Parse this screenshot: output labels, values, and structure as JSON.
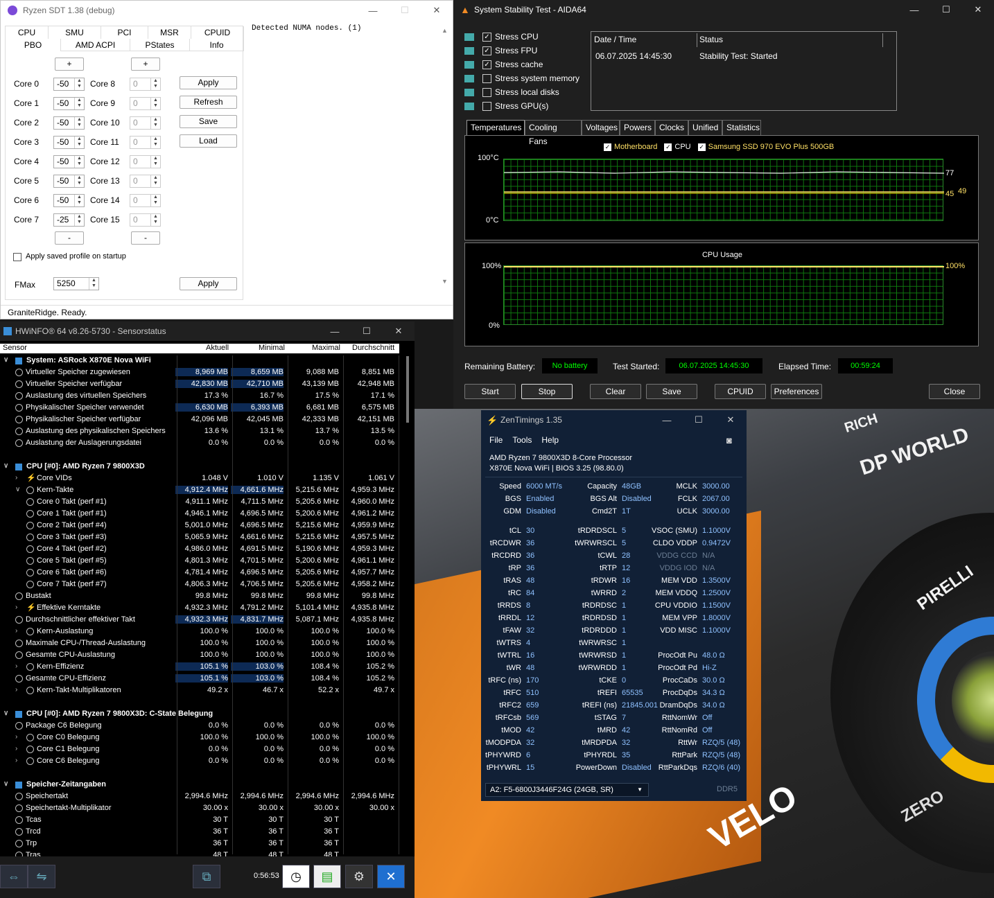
{
  "sdt": {
    "title": "Ryzen SDT 1.38 (debug)",
    "tabs_row1": [
      "CPU",
      "SMU",
      "PCI",
      "MSR",
      "CPUID"
    ],
    "tabs_row2": [
      "PBO",
      "AMD ACPI",
      "PStates",
      "Info"
    ],
    "cores_left": [
      {
        "label": "Core 0",
        "value": "-50"
      },
      {
        "label": "Core 1",
        "value": "-50"
      },
      {
        "label": "Core 2",
        "value": "-50"
      },
      {
        "label": "Core 3",
        "value": "-50"
      },
      {
        "label": "Core 4",
        "value": "-50"
      },
      {
        "label": "Core 5",
        "value": "-50"
      },
      {
        "label": "Core 6",
        "value": "-50"
      },
      {
        "label": "Core 7",
        "value": "-25"
      }
    ],
    "cores_right": [
      {
        "label": "Core 8",
        "value": "0"
      },
      {
        "label": "Core 9",
        "value": "0"
      },
      {
        "label": "Core 10",
        "value": "0"
      },
      {
        "label": "Core 11",
        "value": "0"
      },
      {
        "label": "Core 12",
        "value": "0"
      },
      {
        "label": "Core 13",
        "value": "0"
      },
      {
        "label": "Core 14",
        "value": "0"
      },
      {
        "label": "Core 15",
        "value": "0"
      }
    ],
    "plus": "+",
    "minus": "-",
    "buttons": [
      "Apply",
      "Refresh",
      "Save",
      "Load"
    ],
    "apply_startup": "Apply saved profile on startup",
    "fmax_label": "FMax",
    "fmax_value": "5250",
    "fmax_apply": "Apply",
    "log": "Detected NUMA nodes. (1)",
    "status": "GraniteRidge. Ready."
  },
  "aida": {
    "title": "System Stability Test - AIDA64",
    "stress": [
      {
        "label": "Stress CPU",
        "checked": "✓"
      },
      {
        "label": "Stress FPU",
        "checked": "✓"
      },
      {
        "label": "Stress cache",
        "checked": "✓"
      },
      {
        "label": "Stress system memory",
        "checked": ""
      },
      {
        "label": "Stress local disks",
        "checked": ""
      },
      {
        "label": "Stress GPU(s)",
        "checked": ""
      }
    ],
    "table_headers": [
      "Date / Time",
      "Status"
    ],
    "table_row": [
      "06.07.2025 14:45:30",
      "Stability Test: Started"
    ],
    "tabs": [
      "Temperatures",
      "Cooling Fans",
      "Voltages",
      "Powers",
      "Clocks",
      "Unified",
      "Statistics"
    ],
    "legend": [
      "Motherboard",
      "CPU",
      "Samsung SSD 970 EVO Plus 500GB"
    ],
    "temp_top": "100°C",
    "temp_bottom": "0°C",
    "temp_vals": [
      "77",
      "45",
      "49"
    ],
    "usage_title": "CPU Usage",
    "usage_top": "100%",
    "usage_bottom": "0%",
    "usage_val": "100%",
    "remaining_label": "Remaining Battery:",
    "remaining": "No battery",
    "started_label": "Test Started:",
    "started": "06.07.2025 14:45:30",
    "elapsed_label": "Elapsed Time:",
    "elapsed": "00:59:24",
    "buttons": [
      "Start",
      "Stop",
      "Clear",
      "Save",
      "CPUID",
      "Preferences",
      "Close"
    ]
  },
  "hw": {
    "title": "HWiNFO® 64 v8.26-5730 - Sensorstatus",
    "headers": [
      "Sensor",
      "Aktuell",
      "Minimal",
      "Maximal",
      "Durchschnitt"
    ],
    "time": "0:56:53",
    "rows": [
      {
        "t": "sec",
        "n": "System: ASRock X870E Nova WiFi"
      },
      {
        "t": "r",
        "i": 1,
        "n": "Virtueller Speicher zugewiesen",
        "v": [
          "8,969 MB",
          "8,659 MB",
          "9,088 MB",
          "8,851 MB"
        ],
        "h": 1
      },
      {
        "t": "r",
        "i": 1,
        "n": "Virtueller Speicher verfügbar",
        "v": [
          "42,830 MB",
          "42,710 MB",
          "43,139 MB",
          "42,948 MB"
        ],
        "h": 1
      },
      {
        "t": "r",
        "i": 1,
        "n": "Auslastung des virtuellen Speichers",
        "v": [
          "17.3 %",
          "16.7 %",
          "17.5 %",
          "17.1 %"
        ]
      },
      {
        "t": "r",
        "i": 1,
        "n": "Physikalischer Speicher verwendet",
        "v": [
          "6,630 MB",
          "6,393 MB",
          "6,681 MB",
          "6,575 MB"
        ],
        "h": 1
      },
      {
        "t": "r",
        "i": 1,
        "n": "Physikalischer Speicher verfügbar",
        "v": [
          "42,096 MB",
          "42,045 MB",
          "42,333 MB",
          "42,151 MB"
        ]
      },
      {
        "t": "r",
        "i": 1,
        "n": "Auslastung des physikalischen Speichers",
        "v": [
          "13.6 %",
          "13.1 %",
          "13.7 %",
          "13.5 %"
        ]
      },
      {
        "t": "r",
        "i": 1,
        "n": "Auslastung der Auslagerungsdatei",
        "v": [
          "0.0 %",
          "0.0 %",
          "0.0 %",
          "0.0 %"
        ]
      },
      {
        "t": "blank"
      },
      {
        "t": "sec",
        "n": "CPU [#0]: AMD Ryzen 7 9800X3D"
      },
      {
        "t": "r",
        "i": 2,
        "e": ">",
        "n": "Core VIDs",
        "v": [
          "1.048 V",
          "1.010 V",
          "1.135 V",
          "1.061 V"
        ],
        "bolt": 1
      },
      {
        "t": "r",
        "i": 2,
        "e": "v",
        "n": "Kern-Takte",
        "v": [
          "4,912.4 MHz",
          "4,661.6 MHz",
          "5,215.6 MHz",
          "4,959.3 MHz"
        ],
        "h": 1
      },
      {
        "t": "r",
        "i": 3,
        "n": "Core 0 Takt (perf #1)",
        "v": [
          "4,911.1 MHz",
          "4,711.5 MHz",
          "5,205.6 MHz",
          "4,960.0 MHz"
        ]
      },
      {
        "t": "r",
        "i": 3,
        "n": "Core 1 Takt (perf #1)",
        "v": [
          "4,946.1 MHz",
          "4,696.5 MHz",
          "5,200.6 MHz",
          "4,961.2 MHz"
        ]
      },
      {
        "t": "r",
        "i": 3,
        "n": "Core 2 Takt (perf #4)",
        "v": [
          "5,001.0 MHz",
          "4,696.5 MHz",
          "5,215.6 MHz",
          "4,959.9 MHz"
        ]
      },
      {
        "t": "r",
        "i": 3,
        "n": "Core 3 Takt (perf #3)",
        "v": [
          "5,065.9 MHz",
          "4,661.6 MHz",
          "5,215.6 MHz",
          "4,957.5 MHz"
        ]
      },
      {
        "t": "r",
        "i": 3,
        "n": "Core 4 Takt (perf #2)",
        "v": [
          "4,986.0 MHz",
          "4,691.5 MHz",
          "5,190.6 MHz",
          "4,959.3 MHz"
        ]
      },
      {
        "t": "r",
        "i": 3,
        "n": "Core 5 Takt (perf #5)",
        "v": [
          "4,801.3 MHz",
          "4,701.5 MHz",
          "5,200.6 MHz",
          "4,961.1 MHz"
        ]
      },
      {
        "t": "r",
        "i": 3,
        "n": "Core 6 Takt (perf #6)",
        "v": [
          "4,781.4 MHz",
          "4,696.5 MHz",
          "5,205.6 MHz",
          "4,957.7 MHz"
        ]
      },
      {
        "t": "r",
        "i": 3,
        "n": "Core 7 Takt (perf #7)",
        "v": [
          "4,806.3 MHz",
          "4,706.5 MHz",
          "5,205.6 MHz",
          "4,958.2 MHz"
        ]
      },
      {
        "t": "r",
        "i": 1,
        "n": "Bustakt",
        "v": [
          "99.8 MHz",
          "99.8 MHz",
          "99.8 MHz",
          "99.8 MHz"
        ]
      },
      {
        "t": "r",
        "i": 2,
        "e": ">",
        "n": "Effektive Kerntakte",
        "v": [
          "4,932.3 MHz",
          "4,791.2 MHz",
          "5,101.4 MHz",
          "4,935.8 MHz"
        ],
        "bolt": 1
      },
      {
        "t": "r",
        "i": 1,
        "n": "Durchschnittlicher effektiver Takt",
        "v": [
          "4,932.3 MHz",
          "4,831.7 MHz",
          "5,087.1 MHz",
          "4,935.8 MHz"
        ],
        "h": 1
      },
      {
        "t": "r",
        "i": 2,
        "e": ">",
        "n": "Kern-Auslastung",
        "v": [
          "100.0 %",
          "100.0 %",
          "100.0 %",
          "100.0 %"
        ]
      },
      {
        "t": "r",
        "i": 1,
        "n": "Maximale CPU-/Thread-Auslastung",
        "v": [
          "100.0 %",
          "100.0 %",
          "100.0 %",
          "100.0 %"
        ]
      },
      {
        "t": "r",
        "i": 1,
        "n": "Gesamte CPU-Auslastung",
        "v": [
          "100.0 %",
          "100.0 %",
          "100.0 %",
          "100.0 %"
        ]
      },
      {
        "t": "r",
        "i": 2,
        "e": ">",
        "n": "Kern-Effizienz",
        "v": [
          "105.1 %",
          "103.0 %",
          "108.4 %",
          "105.2 %"
        ],
        "h": 1
      },
      {
        "t": "r",
        "i": 1,
        "n": "Gesamte CPU-Effizienz",
        "v": [
          "105.1 %",
          "103.0 %",
          "108.4 %",
          "105.2 %"
        ],
        "h": 1
      },
      {
        "t": "r",
        "i": 2,
        "e": ">",
        "n": "Kern-Takt-Multiplikatoren",
        "v": [
          "49.2 x",
          "46.7 x",
          "52.2 x",
          "49.7 x"
        ]
      },
      {
        "t": "blank"
      },
      {
        "t": "sec",
        "n": "CPU [#0]: AMD Ryzen 7 9800X3D: C-State Belegung"
      },
      {
        "t": "r",
        "i": 1,
        "n": "Package C6 Belegung",
        "v": [
          "0.0 %",
          "0.0 %",
          "0.0 %",
          "0.0 %"
        ]
      },
      {
        "t": "r",
        "i": 2,
        "e": ">",
        "n": "Core C0 Belegung",
        "v": [
          "100.0 %",
          "100.0 %",
          "100.0 %",
          "100.0 %"
        ]
      },
      {
        "t": "r",
        "i": 2,
        "e": ">",
        "n": "Core C1 Belegung",
        "v": [
          "0.0 %",
          "0.0 %",
          "0.0 %",
          "0.0 %"
        ]
      },
      {
        "t": "r",
        "i": 2,
        "e": ">",
        "n": "Core C6 Belegung",
        "v": [
          "0.0 %",
          "0.0 %",
          "0.0 %",
          "0.0 %"
        ]
      },
      {
        "t": "blank"
      },
      {
        "t": "sec",
        "n": "Speicher-Zeitangaben"
      },
      {
        "t": "r",
        "i": 1,
        "n": "Speichertakt",
        "v": [
          "2,994.6 MHz",
          "2,994.6 MHz",
          "2,994.6 MHz",
          "2,994.6 MHz"
        ]
      },
      {
        "t": "r",
        "i": 1,
        "n": "Speichertakt-Multiplikator",
        "v": [
          "30.00 x",
          "30.00 x",
          "30.00 x",
          "30.00 x"
        ]
      },
      {
        "t": "r",
        "i": 1,
        "n": "Tcas",
        "v": [
          "30 T",
          "30 T",
          "30 T",
          ""
        ]
      },
      {
        "t": "r",
        "i": 1,
        "n": "Trcd",
        "v": [
          "36 T",
          "36 T",
          "36 T",
          ""
        ]
      },
      {
        "t": "r",
        "i": 1,
        "n": "Trp",
        "v": [
          "36 T",
          "36 T",
          "36 T",
          ""
        ]
      },
      {
        "t": "r",
        "i": 1,
        "n": "Tras",
        "v": [
          "48 T",
          "48 T",
          "48 T",
          ""
        ]
      }
    ]
  },
  "zt": {
    "title": "ZenTimings 1.35",
    "menu": [
      "File",
      "Tools",
      "Help"
    ],
    "cpu": "AMD Ryzen 7 9800X3D 8-Core Processor",
    "board": "X870E Nova WiFi | BIOS 3.25 (98.80.0)",
    "top": [
      [
        [
          "Speed",
          "6000 MT/s"
        ],
        [
          "Capacity",
          "48GB"
        ],
        [
          "MCLK",
          "3000.00"
        ]
      ],
      [
        [
          "BGS",
          "Enabled"
        ],
        [
          "BGS Alt",
          "Disabled"
        ],
        [
          "FCLK",
          "2067.00"
        ]
      ],
      [
        [
          "GDM",
          "Disabled"
        ],
        [
          "Cmd2T",
          "1T"
        ],
        [
          "UCLK",
          "3000.00"
        ]
      ]
    ],
    "timings": [
      [
        [
          "tCL",
          "30"
        ],
        [
          "tRDRDSCL",
          "5"
        ],
        [
          "VSOC (SMU)",
          "1.1000V"
        ]
      ],
      [
        [
          "tRCDWR",
          "36"
        ],
        [
          "tWRWRSCL",
          "5"
        ],
        [
          "CLDO VDDP",
          "0.9472V"
        ]
      ],
      [
        [
          "tRCDRD",
          "36"
        ],
        [
          "tCWL",
          "28"
        ],
        [
          "VDDG CCD",
          "N/A"
        ]
      ],
      [
        [
          "tRP",
          "36"
        ],
        [
          "tRTP",
          "12"
        ],
        [
          "VDDG IOD",
          "N/A"
        ]
      ],
      [
        [
          "tRAS",
          "48"
        ],
        [
          "tRDWR",
          "16"
        ],
        [
          "MEM VDD",
          "1.3500V"
        ]
      ],
      [
        [
          "tRC",
          "84"
        ],
        [
          "tWRRD",
          "2"
        ],
        [
          "MEM VDDQ",
          "1.2500V"
        ]
      ],
      [
        [
          "tRRDS",
          "8"
        ],
        [
          "tRDRDSC",
          "1"
        ],
        [
          "CPU VDDIO",
          "1.1500V"
        ]
      ],
      [
        [
          "tRRDL",
          "12"
        ],
        [
          "tRDRDSD",
          "1"
        ],
        [
          "MEM VPP",
          "1.8000V"
        ]
      ],
      [
        [
          "tFAW",
          "32"
        ],
        [
          "tRDRDDD",
          "1"
        ],
        [
          "VDD MISC",
          "1.1000V"
        ]
      ],
      [
        [
          "tWTRS",
          "4"
        ],
        [
          "tWRWRSC",
          "1"
        ],
        [
          "",
          ""
        ]
      ],
      [
        [
          "tWTRL",
          "16"
        ],
        [
          "tWRWRSD",
          "1"
        ],
        [
          "ProcOdt Pu",
          "48.0 Ω"
        ]
      ],
      [
        [
          "tWR",
          "48"
        ],
        [
          "tWRWRDD",
          "1"
        ],
        [
          "ProcOdt Pd",
          "Hi-Z"
        ]
      ],
      [
        [
          "tRFC (ns)",
          "170"
        ],
        [
          "tCKE",
          "0"
        ],
        [
          "ProcCaDs",
          "30.0 Ω"
        ]
      ],
      [
        [
          "tRFC",
          "510"
        ],
        [
          "tREFI",
          "65535"
        ],
        [
          "ProcDqDs",
          "34.3 Ω"
        ]
      ],
      [
        [
          "tRFC2",
          "659"
        ],
        [
          "tREFI (ns)",
          "21845.001"
        ],
        [
          "DramDqDs",
          "34.0 Ω"
        ]
      ],
      [
        [
          "tRFCsb",
          "569"
        ],
        [
          "tSTAG",
          "7"
        ],
        [
          "RttNomWr",
          "Off"
        ]
      ],
      [
        [
          "tMOD",
          "42"
        ],
        [
          "tMRD",
          "42"
        ],
        [
          "RttNomRd",
          "Off"
        ]
      ],
      [
        [
          "tMODPDA",
          "32"
        ],
        [
          "tMRDPDA",
          "32"
        ],
        [
          "RttWr",
          "RZQ/5 (48)"
        ]
      ],
      [
        [
          "tPHYWRD",
          "6"
        ],
        [
          "tPHYRDL",
          "35"
        ],
        [
          "RttPark",
          "RZQ/5 (48)"
        ]
      ],
      [
        [
          "tPHYWRL",
          "15"
        ],
        [
          "PowerDown",
          "Disabled"
        ],
        [
          "RttParkDqs",
          "RZQ/6 (40)"
        ]
      ]
    ],
    "module": "A2: F5-6800J3446F24G (24GB, SR)",
    "ddr": "DDR5"
  },
  "wall": {
    "t1": "DP WORLD",
    "t2": "RICH",
    "t3": "PIRELLI",
    "t4": "VELO",
    "t5": "ZERO"
  }
}
